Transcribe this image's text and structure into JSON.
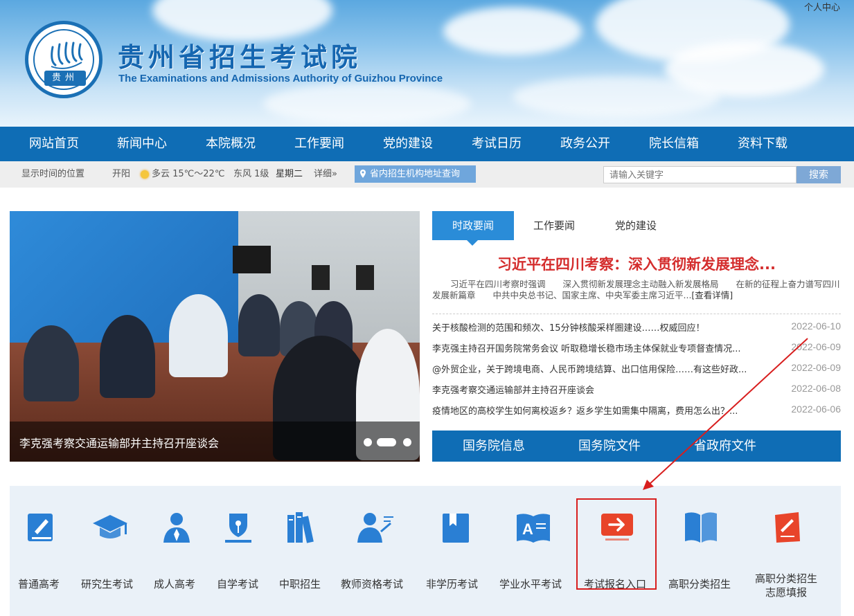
{
  "header": {
    "user_center": "个人中心",
    "logo_text": "贵州",
    "title": "贵州省招生考试院",
    "subtitle": "The Examinations and Admissions Authority of Guizhou Province"
  },
  "nav": {
    "items": [
      "网站首页",
      "新闻中心",
      "本院概况",
      "工作要闻",
      "党的建设",
      "考试日历",
      "政务公开",
      "院长信箱",
      "资料下载"
    ]
  },
  "infobar": {
    "location_text": "显示时间的位置",
    "city": "开阳",
    "weather": "多云 15℃～22℃",
    "wind": "东风 1级",
    "weekday": "星期二",
    "detail": "详细»",
    "address_button": "省内招生机构地址查询",
    "search_placeholder": "请输入关键字",
    "search_button": "搜索"
  },
  "slideshow": {
    "caption": "李克强考察交通运输部并主持召开座谈会"
  },
  "news": {
    "tabs": [
      "时政要闻",
      "工作要闻",
      "党的建设"
    ],
    "headline": "习近平在四川考察：深入贯彻新发展理念...",
    "summary": "习近平在四川考察时强调　　深入贯彻新发展理念主动融入新发展格局　　在新的征程上奋力谱写四川发展新篇章　　中共中央总书记、国家主席、中央军委主席习近平...",
    "summary_link": "[查看详情]",
    "items": [
      {
        "title": "关于核酸检测的范围和频次、15分钟核酸采样圈建设……权威回应！",
        "date": "2022-06-10"
      },
      {
        "title": "李克强主持召开国务院常务会议 听取稳增长稳市场主体保就业专项督查情况...",
        "date": "2022-06-09"
      },
      {
        "title": "@外贸企业，关于跨境电商、人民币跨境结算、出口信用保险……有这些好政...",
        "date": "2022-06-09"
      },
      {
        "title": "李克强考察交通运输部并主持召开座谈会",
        "date": "2022-06-08"
      },
      {
        "title": "疫情地区的高校学生如何离校返乡？返乡学生如需集中隔离，费用怎么出？...",
        "date": "2022-06-06"
      }
    ],
    "subtabs": [
      "国务院信息",
      "国务院文件",
      "省政府文件"
    ]
  },
  "services": {
    "items": [
      {
        "label": "普通高考",
        "icon": "pen-book-icon",
        "color": "#2a7fd4"
      },
      {
        "label": "研究生考试",
        "icon": "graduation-cap-icon",
        "color": "#2a7fd4"
      },
      {
        "label": "成人高考",
        "icon": "person-tie-icon",
        "color": "#2a7fd4"
      },
      {
        "label": "自学考试",
        "icon": "pen-nib-icon",
        "color": "#2a7fd4"
      },
      {
        "label": "中职招生",
        "icon": "books-icon",
        "color": "#2a7fd4"
      },
      {
        "label": "教师资格考试",
        "icon": "teacher-icon",
        "color": "#2a7fd4"
      },
      {
        "label": "非学历考试",
        "icon": "bookmark-book-icon",
        "color": "#2a7fd4"
      },
      {
        "label": "学业水平考试",
        "icon": "letter-a-book-icon",
        "color": "#2a7fd4"
      },
      {
        "label": "考试报名入口",
        "icon": "arrow-enter-icon",
        "color": "#e8442a"
      },
      {
        "label": "高职分类招生",
        "icon": "open-book-icon",
        "color": "#2a7fd4"
      },
      {
        "label": "高职分类招生志愿填报",
        "label_line1": "高职分类招生",
        "label_line2": "志愿填报",
        "icon": "form-pen-icon",
        "color": "#e8442a"
      }
    ]
  }
}
